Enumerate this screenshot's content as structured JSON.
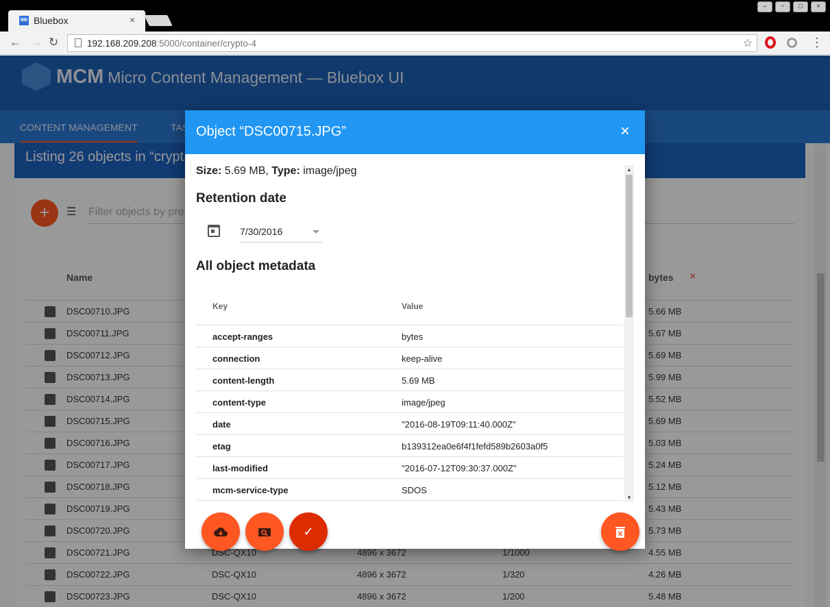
{
  "browser": {
    "tab_title": "Bluebox",
    "favicon_text": "BB",
    "tab_close": "×",
    "url_host": "192.168.209.208",
    "url_rest": ":5000/container/crypto-4",
    "icons": [
      "back-arrow-icon",
      "forward-arrow-icon",
      "reload-icon",
      "page-icon",
      "bookmark-star-icon",
      "opera-extension-icon",
      "extension-icon",
      "menu-dots-icon"
    ]
  },
  "app": {
    "title_short": "MCM",
    "title_long": "Micro Content Management — Bluebox UI",
    "nav": [
      {
        "label": "CONTENT MANAGEMENT"
      },
      {
        "label": "TAS"
      }
    ],
    "listing_title": "Listing 26 objects in “crypt",
    "filter_placeholder": "Filter objects by pre",
    "columns": {
      "name": "Name",
      "bytes": "bytes",
      "clear": "×"
    },
    "rows": [
      {
        "name": "DSC00710.JPG",
        "model": "",
        "res": "",
        "exp": "",
        "size": "5.66 MB"
      },
      {
        "name": "DSC00711.JPG",
        "model": "",
        "res": "",
        "exp": "",
        "size": "5.67 MB"
      },
      {
        "name": "DSC00712.JPG",
        "model": "",
        "res": "",
        "exp": "",
        "size": "5.69 MB"
      },
      {
        "name": "DSC00713.JPG",
        "model": "",
        "res": "",
        "exp": "",
        "size": "5.99 MB"
      },
      {
        "name": "DSC00714.JPG",
        "model": "",
        "res": "",
        "exp": "",
        "size": "5.52 MB"
      },
      {
        "name": "DSC00715.JPG",
        "model": "",
        "res": "",
        "exp": "",
        "size": "5.69 MB"
      },
      {
        "name": "DSC00716.JPG",
        "model": "",
        "res": "",
        "exp": "",
        "size": "5.03 MB"
      },
      {
        "name": "DSC00717.JPG",
        "model": "",
        "res": "",
        "exp": "",
        "size": "5.24 MB"
      },
      {
        "name": "DSC00718.JPG",
        "model": "",
        "res": "",
        "exp": "",
        "size": "5.12 MB"
      },
      {
        "name": "DSC00719.JPG",
        "model": "",
        "res": "",
        "exp": "",
        "size": "5.43 MB"
      },
      {
        "name": "DSC00720.JPG",
        "model": "",
        "res": "",
        "exp": "",
        "size": "5.73 MB"
      },
      {
        "name": "DSC00721.JPG",
        "model": "DSC-QX10",
        "res": "4896 x 3672",
        "exp": "1/1000",
        "size": "4.55 MB"
      },
      {
        "name": "DSC00722.JPG",
        "model": "DSC-QX10",
        "res": "4896 x 3672",
        "exp": "1/320",
        "size": "4.26 MB"
      },
      {
        "name": "DSC00723.JPG",
        "model": "DSC-QX10",
        "res": "4896 x 3672",
        "exp": "1/200",
        "size": "5.48 MB"
      }
    ]
  },
  "modal": {
    "title": "Object “DSC00715.JPG”",
    "close": "×",
    "size_label": "Size:",
    "size_value": "5.69 MB,",
    "type_label": "Type:",
    "type_value": "image/jpeg",
    "retention_title": "Retention date",
    "retention_date": "7/30/2016",
    "metadata_title": "All object metadata",
    "table_headers": {
      "key": "Key",
      "value": "Value"
    },
    "metadata": [
      {
        "key": "accept-ranges",
        "value": "bytes"
      },
      {
        "key": "connection",
        "value": "keep-alive"
      },
      {
        "key": "content-length",
        "value": "5.69 MB"
      },
      {
        "key": "content-type",
        "value": "image/jpeg"
      },
      {
        "key": "date",
        "value": "\"2016-08-19T09:11:40.000Z\""
      },
      {
        "key": "etag",
        "value": "b139312ea0e6f4f1fefd589b2603a0f5"
      },
      {
        "key": "last-modified",
        "value": "\"2016-07-12T09:30:37.000Z\""
      },
      {
        "key": "mcm-service-type",
        "value": "SDOS"
      }
    ],
    "actions": [
      "download-icon",
      "preview-icon",
      "confirm-icon",
      "delete-icon"
    ],
    "colors": {
      "header": "#2196f3",
      "fab": "#ff5722",
      "fab_confirm": "#dd2c00"
    }
  }
}
